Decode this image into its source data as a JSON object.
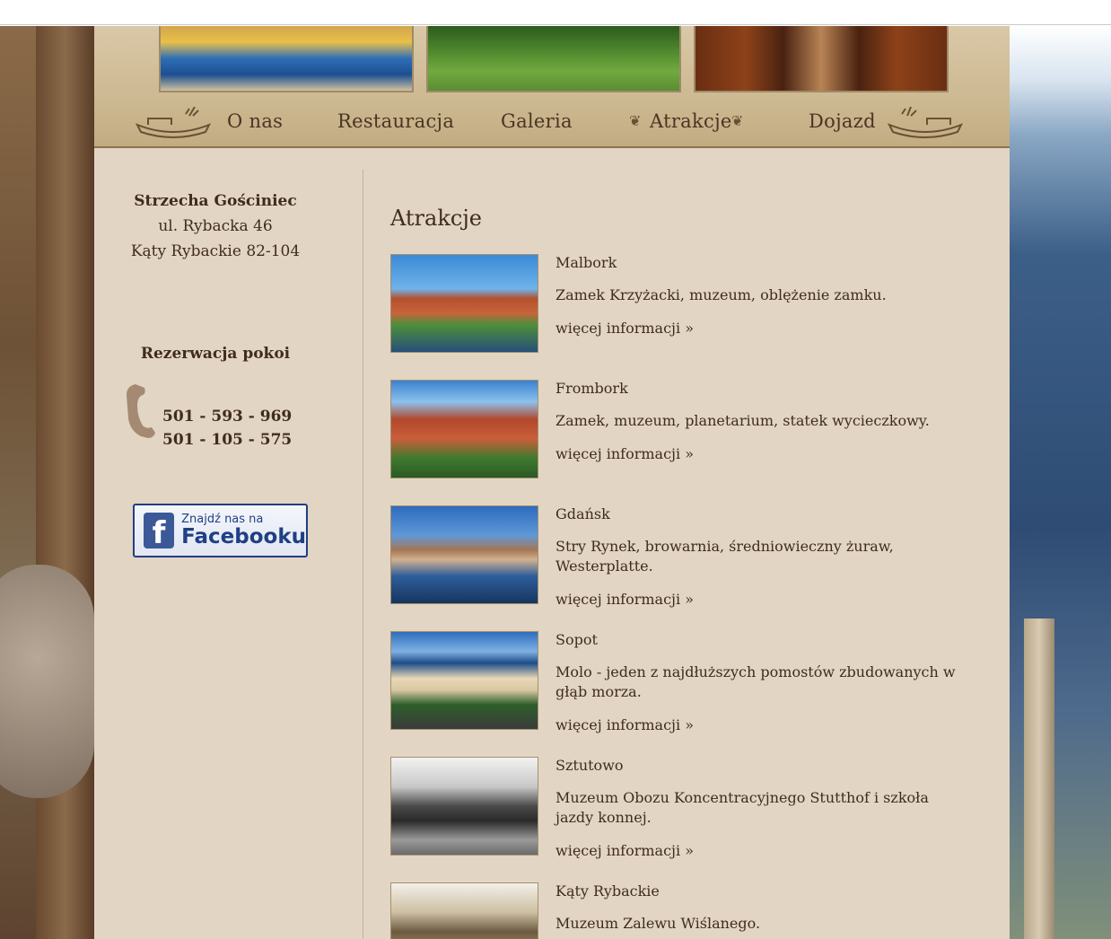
{
  "header": {
    "photos": [
      "boats-photo",
      "garden-photo",
      "hallway-photo"
    ]
  },
  "nav": {
    "items": [
      {
        "label": "O nas"
      },
      {
        "label": "Restauracja"
      },
      {
        "label": "Galeria"
      },
      {
        "label": "Atrakcje"
      },
      {
        "label": "Dojazd"
      }
    ]
  },
  "sidebar": {
    "address": {
      "name": "Strzecha Gościniec",
      "street": "ul. Rybacka 46",
      "city": "Kąty Rybackie 82-104"
    },
    "reservation": {
      "title": "Rezerwacja pokoi",
      "phones": [
        "501 - 593 - 969",
        "501 - 105 - 575"
      ]
    },
    "facebook": {
      "small": "Znajdź nas na",
      "big": "Facebooku"
    }
  },
  "content": {
    "title": "Atrakcje",
    "more_link": "więcej informacji »",
    "items": [
      {
        "name": "Malbork",
        "desc": "Zamek Krzyżacki, muzeum, oblężenie zamku."
      },
      {
        "name": "Frombork",
        "desc": "Zamek, muzeum, planetarium, statek wycieczkowy."
      },
      {
        "name": "Gdańsk",
        "desc": "Stry Rynek, browarnia, średniowieczny żuraw, Westerplatte."
      },
      {
        "name": "Sopot",
        "desc": "Molo - jeden z najdłuższych pomostów zbudowanych w głąb morza."
      },
      {
        "name": "Sztutowo",
        "desc": "Muzeum Obozu Koncentracyjnego Stutthof i szkoła jazdy konnej."
      },
      {
        "name": "Kąty Rybackie",
        "desc": "Muzeum Zalewu Wiślanego."
      }
    ]
  },
  "colors": {
    "text": "#3f2c1e",
    "page_bg": "#e3d5c3",
    "header_bg": "#cdb992",
    "facebook": "#3b5998"
  }
}
